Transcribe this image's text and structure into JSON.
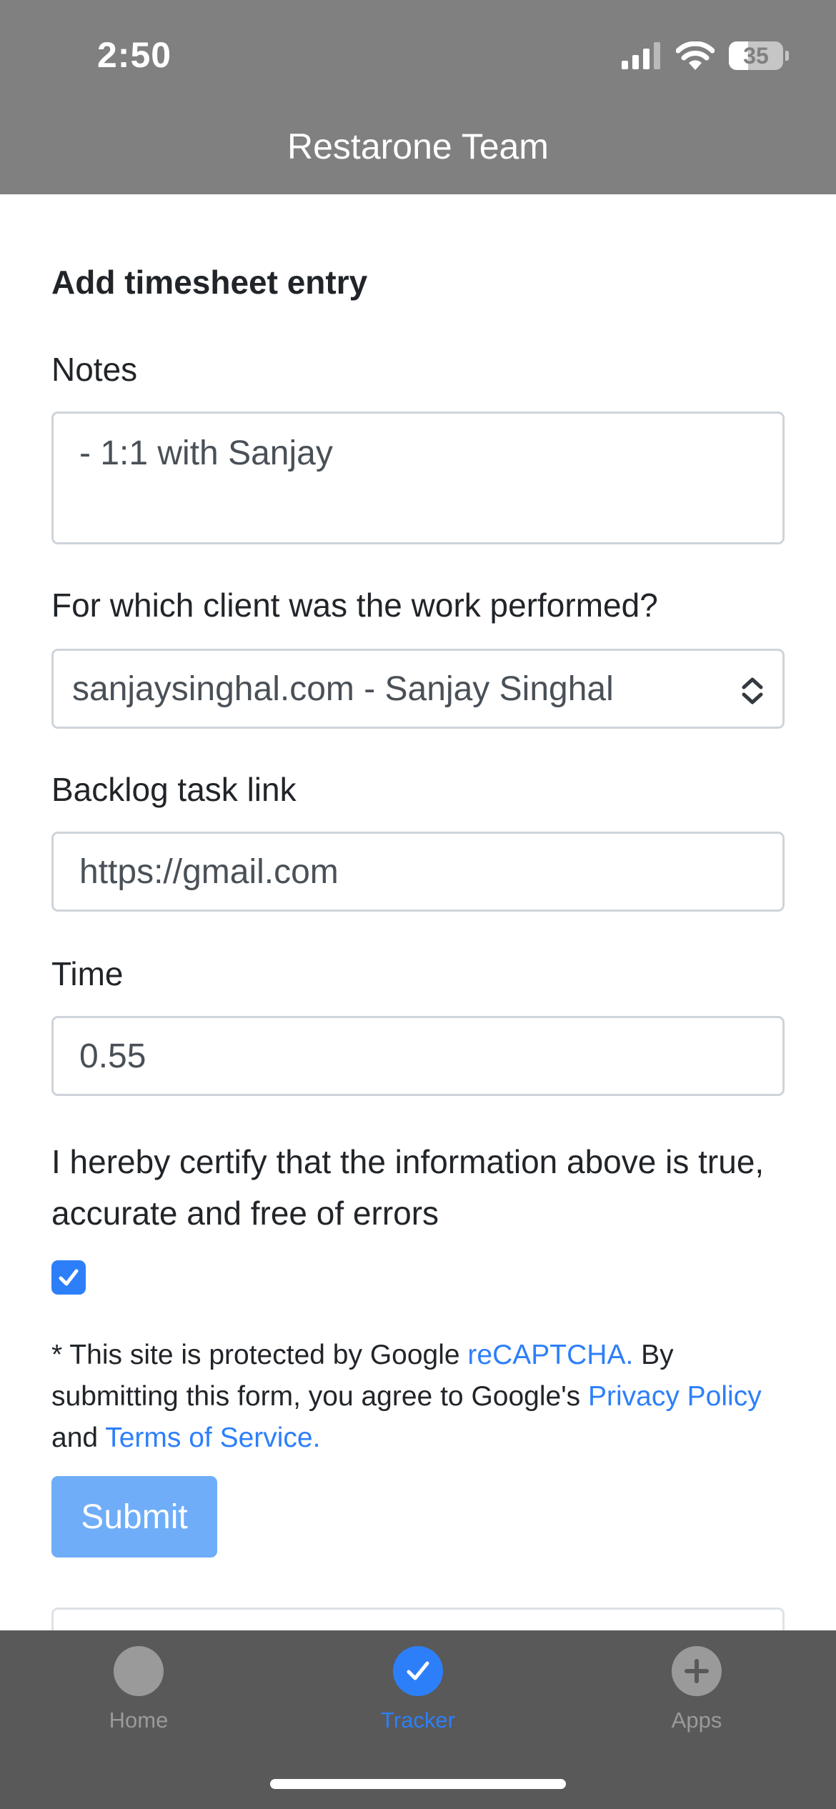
{
  "status_bar": {
    "time": "2:50",
    "battery_level": "35",
    "battery_fraction": 0.35
  },
  "app": {
    "title": "Restarone Team"
  },
  "form": {
    "title": "Add timesheet entry",
    "notes_label": "Notes",
    "notes_value": "- 1:1 with Sanjay",
    "client_label": "For which client was the work performed?",
    "client_value": "sanjaysinghal.com - Sanjay Singhal",
    "backlog_label": "Backlog task link",
    "backlog_value": "https://gmail.com",
    "time_label": "Time",
    "time_value": "0.55",
    "certify_text": "I hereby certify that the information above is true, accurate and free of errors",
    "certify_checked": true,
    "notice": {
      "prefix": "* This site is protected by Google ",
      "recaptcha_link": "reCAPTCHA.",
      "middle": " By submitting this form, you agree to Google's ",
      "privacy_link": "Privacy Policy",
      "and_text": " and ",
      "terms_link": "Terms of Service."
    },
    "submit_label": "Submit"
  },
  "tabbar": {
    "items": [
      {
        "label": "Home",
        "icon": "circle-icon",
        "active": false
      },
      {
        "label": "Tracker",
        "icon": "checkmark-icon",
        "active": true
      },
      {
        "label": "Apps",
        "icon": "plus-icon",
        "active": false
      }
    ]
  },
  "colors": {
    "header_bg": "#808080",
    "accent": "#2d7ff9",
    "submit_disabled": "#6fadf8",
    "tabbar_bg": "#595959",
    "tab_inactive": "#9a9a9a"
  }
}
